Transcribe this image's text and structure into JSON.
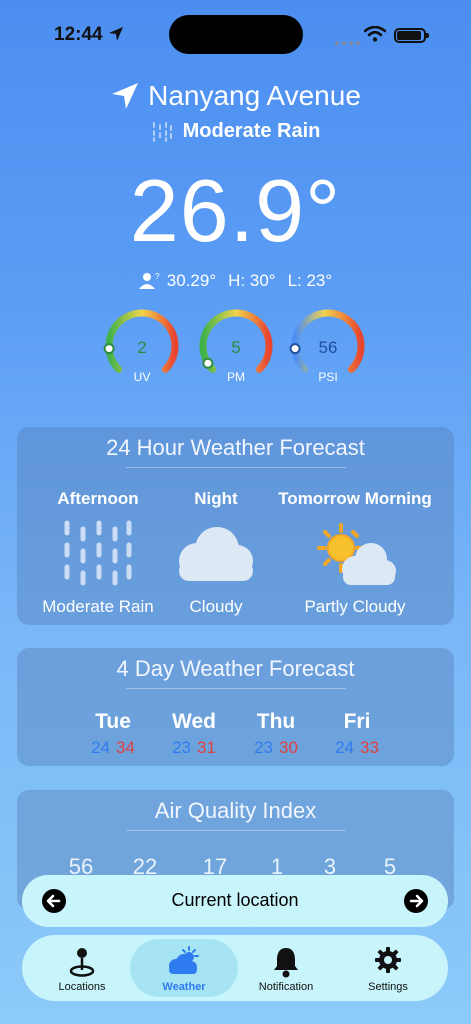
{
  "status_bar": {
    "time": "12:44"
  },
  "header": {
    "location": "Nanyang Avenue",
    "condition": "Moderate Rain",
    "temperature": "26.9°",
    "feels_like": "30.29°",
    "high": "H: 30°",
    "low": "L: 23°"
  },
  "gauges": [
    {
      "label": "UV",
      "value": "2",
      "level": 0.15,
      "color": "#2e8b3e"
    },
    {
      "label": "PM",
      "value": "5",
      "level": 0.05,
      "color": "#2e8b3e"
    },
    {
      "label": "PSI",
      "value": "56",
      "level": 0.15,
      "color": "#1f4fa0"
    }
  ],
  "forecast_24h": {
    "title": "24 Hour Weather Forecast",
    "periods": [
      {
        "name": "Afternoon",
        "condition": "Moderate Rain",
        "icon": "rain-icon"
      },
      {
        "name": "Night",
        "condition": "Cloudy",
        "icon": "cloud-icon"
      },
      {
        "name": "Tomorrow Morning",
        "condition": "Partly Cloudy",
        "icon": "partly-cloudy-icon"
      }
    ]
  },
  "forecast_4day": {
    "title": "4 Day Weather Forecast",
    "days": [
      {
        "name": "Tue",
        "low": "24",
        "high": "34"
      },
      {
        "name": "Wed",
        "low": "23",
        "high": "31"
      },
      {
        "name": "Thu",
        "low": "23",
        "high": "30"
      },
      {
        "name": "Fri",
        "low": "24",
        "high": "33"
      }
    ]
  },
  "aqi": {
    "title": "Air Quality Index",
    "values": [
      "56",
      "22",
      "17",
      "1",
      "3",
      "5"
    ]
  },
  "location_bar": {
    "label": "Current location"
  },
  "tabbar": {
    "tabs": [
      {
        "label": "Locations",
        "icon": "map-pin-icon"
      },
      {
        "label": "Weather",
        "icon": "weather-icon"
      },
      {
        "label": "Notification",
        "icon": "bell-icon"
      },
      {
        "label": "Settings",
        "icon": "gear-icon"
      }
    ],
    "active": "Weather"
  },
  "colors": {
    "low_temp": "#2f7cf0",
    "high_temp": "#e0413f",
    "accent": "#2f7cf0"
  }
}
